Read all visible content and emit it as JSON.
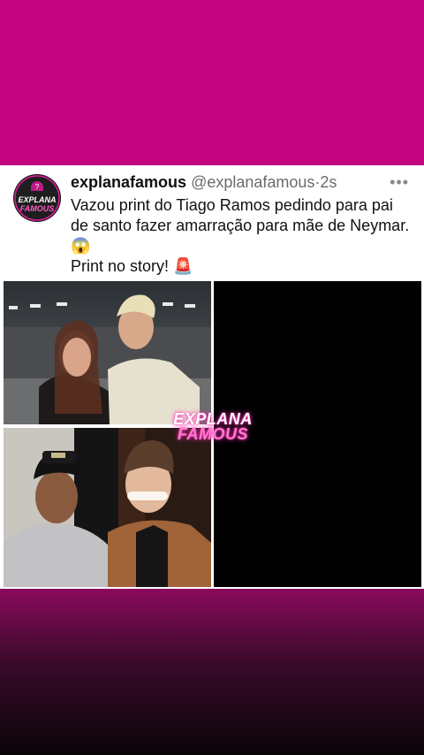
{
  "post": {
    "display_name": "explanafamous",
    "handle": "@explanafamous",
    "separator": "·",
    "time": "2s",
    "more_label": "•••",
    "text_line1": "Vazou print do Tiago Ramos pedindo para pai de santo fazer amarração para mãe de Neymar. 😱",
    "text_line2": "Print no story! 🚨"
  },
  "avatar": {
    "line1": "EXPLANA",
    "line2": "FAMOUS"
  },
  "watermark": {
    "line1": "EXPLANA",
    "line2": "FAMOUS"
  },
  "colors": {
    "background_top": "#c2047f",
    "card": "#ffffff",
    "accent_pink": "#ff2fb5"
  }
}
